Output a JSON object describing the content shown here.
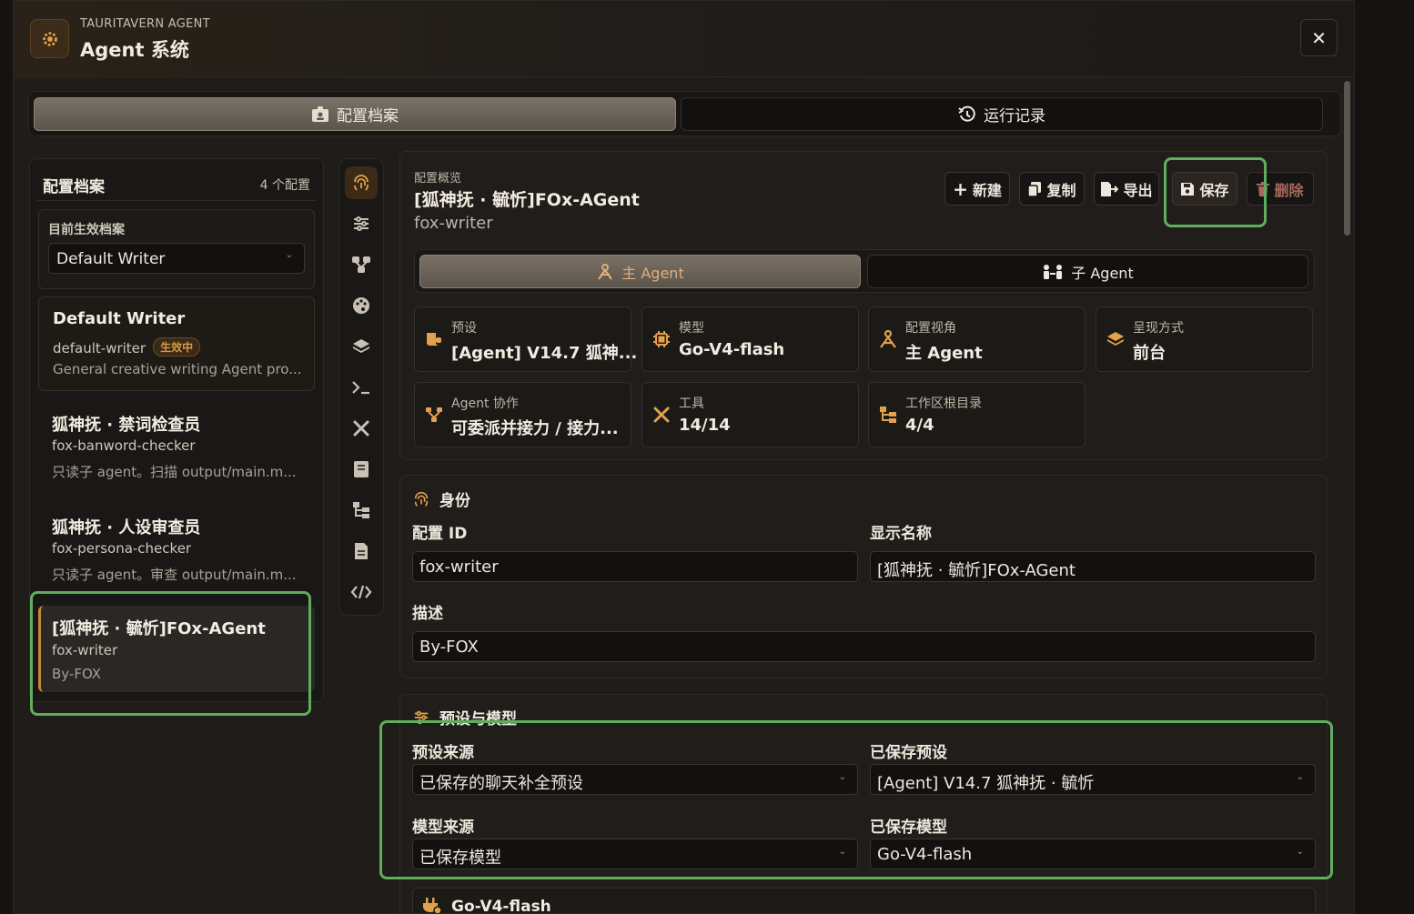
{
  "header": {
    "brand": "TAURITAVERN AGENT",
    "title": "Agent 系统",
    "close": "✕"
  },
  "main_tabs": [
    {
      "label": "配置档案",
      "icon": "id-badge-icon"
    },
    {
      "label": "运行记录",
      "icon": "history-icon"
    }
  ],
  "left_panel": {
    "title": "配置档案",
    "count": "4 个配置",
    "active_label": "目前生效档案",
    "active_value": "Default Writer",
    "profiles": [
      {
        "name": "Default Writer",
        "id": "default-writer",
        "badge": "生效中",
        "desc": "General creative writing Agent pro..."
      },
      {
        "name": "狐神抚 · 禁词检查员",
        "id": "fox-banword-checker",
        "desc": "只读子 agent。扫描 output/main.m..."
      },
      {
        "name": "狐神抚 · 人设审查员",
        "id": "fox-persona-checker",
        "desc": "只读子 agent。审查 output/main.m..."
      },
      {
        "name": "[狐神抚 · 毓忻]FOx-AGent",
        "id": "fox-writer",
        "desc": "By-FOX"
      }
    ]
  },
  "rail": [
    "fingerprint-icon",
    "sliders-icon",
    "nodes-icon",
    "palette-icon",
    "layers-icon",
    "terminal-icon",
    "tools-icon",
    "book-icon",
    "tree-icon",
    "document-icon",
    "code-icon"
  ],
  "overview": {
    "label": "配置概览",
    "title": "[狐神抚 · 毓忻]FOx-AGent",
    "subtitle": "fox-writer",
    "actions": {
      "new": "新建",
      "copy": "复制",
      "export": "导出",
      "save": "保存",
      "delete": "删除"
    },
    "sub_tabs": {
      "main": "主 Agent",
      "sub": "子 Agent"
    },
    "stats": [
      {
        "label": "预设",
        "value": "[Agent] V14.7 狐神...",
        "icon": "scroll-icon"
      },
      {
        "label": "模型",
        "value": "Go-V4-flash",
        "icon": "chip-icon"
      },
      {
        "label": "配置视角",
        "value": "主 Agent",
        "icon": "agent-icon"
      },
      {
        "label": "呈现方式",
        "value": "前台",
        "icon": "layers-icon"
      },
      {
        "label": "Agent 协作",
        "value": "可委派并接力 / 接力...",
        "icon": "branch-icon"
      },
      {
        "label": "工具",
        "value": "14/14",
        "icon": "tools-icon"
      },
      {
        "label": "工作区根目录",
        "value": "4/4",
        "icon": "tree-icon"
      }
    ]
  },
  "identity": {
    "heading": "身份",
    "config_id_label": "配置 ID",
    "config_id_value": "fox-writer",
    "display_name_label": "显示名称",
    "display_name_value": "[狐神抚 · 毓忻]FOx-AGent",
    "desc_label": "描述",
    "desc_value": "By-FOX"
  },
  "preset_model": {
    "heading": "预设与模型",
    "preset_source_label": "预设来源",
    "preset_source_value": "已保存的聊天补全预设",
    "saved_preset_label": "已保存预设",
    "saved_preset_value": "[Agent] V14.7 狐神抚 · 毓忻",
    "model_source_label": "模型来源",
    "model_source_value": "已保存模型",
    "saved_model_label": "已保存模型",
    "saved_model_value": "Go-V4-flash"
  },
  "model_card": {
    "title": "Go-V4-flash"
  },
  "colors": {
    "accent": "#d9953f",
    "highlight": "#5fae5d"
  }
}
